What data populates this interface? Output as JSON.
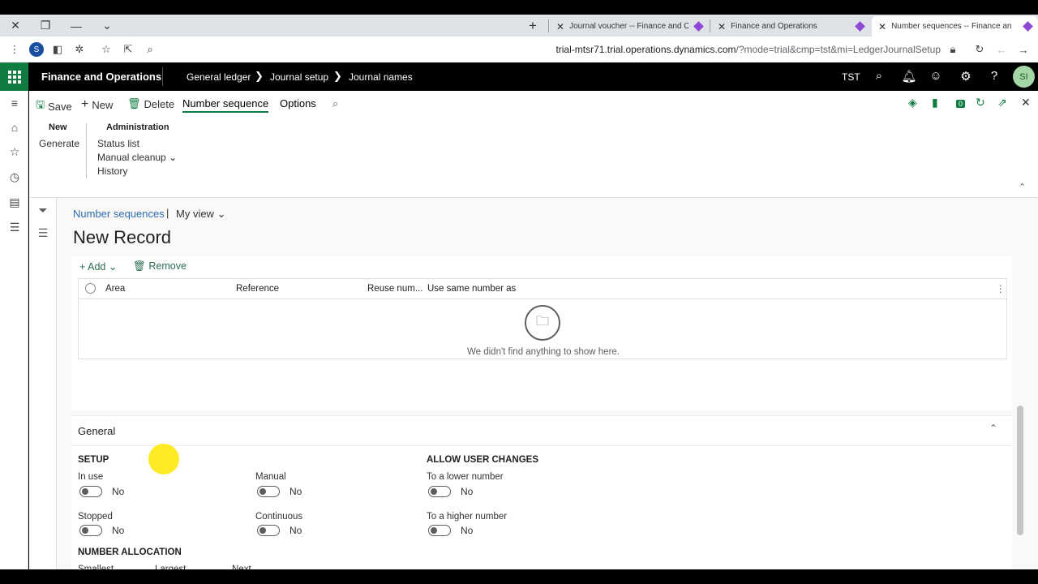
{
  "browser": {
    "tabs": [
      {
        "label": "Journal voucher -- Finance and O"
      },
      {
        "label": "Finance and Operations"
      },
      {
        "label": "Number sequences -- Finance an"
      }
    ],
    "profile_initial": "S",
    "url_host": "trial-mtsr71.trial.operations.dynamics.com",
    "url_rest": "/?mode=trial&cmp=tst&mi=LedgerJournalSetup"
  },
  "nav": {
    "app_name": "Finance and Operations",
    "breadcrumbs": [
      "General ledger",
      "Journal setup",
      "Journal names"
    ],
    "company": "TST",
    "notification_count": "1",
    "user_initials": "SI"
  },
  "actions": {
    "save": "Save",
    "new": "New",
    "delete": "Delete",
    "number_sequence": "Number sequence",
    "options": "Options",
    "badge_count": "0"
  },
  "ribbon": {
    "group_new": "New",
    "generate": "Generate",
    "group_admin": "Administration",
    "status_list": "Status list",
    "manual_cleanup": "Manual cleanup",
    "history": "History"
  },
  "page": {
    "breadcrumb": "Number sequences",
    "view": "My view",
    "title": "New Record"
  },
  "grid": {
    "add": "Add",
    "remove": "Remove",
    "columns": [
      "Area",
      "Reference",
      "Reuse num...",
      "Use same number as"
    ],
    "empty_text": "We didn't find anything to show here."
  },
  "general": {
    "header": "General",
    "setup_heading": "SETUP",
    "allow_heading": "ALLOW USER CHANGES",
    "allocation_heading": "NUMBER ALLOCATION",
    "fields": {
      "in_use": {
        "label": "In use",
        "value": "No"
      },
      "manual": {
        "label": "Manual",
        "value": "No"
      },
      "lower": {
        "label": "To a lower number",
        "value": "No"
      },
      "stopped": {
        "label": "Stopped",
        "value": "No"
      },
      "continuous": {
        "label": "Continuous",
        "value": "No"
      },
      "higher": {
        "label": "To a higher number",
        "value": "No"
      }
    },
    "allocation_cols": [
      "Smallest",
      "Largest",
      "Next"
    ]
  },
  "colors": {
    "brand": "#107c41",
    "link": "#2b6cb0"
  }
}
